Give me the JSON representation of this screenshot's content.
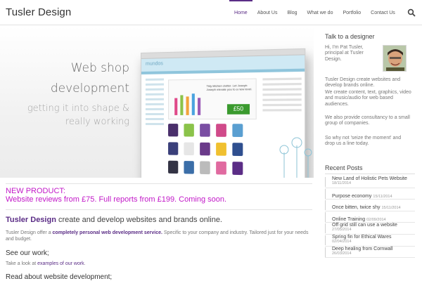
{
  "header": {
    "site_title": "Tusler Design",
    "nav": [
      "Home",
      "About Us",
      "Blog",
      "What we do",
      "Portfolio",
      "Contact Us"
    ],
    "active_nav": "Home",
    "search_icon": "search-icon"
  },
  "banner": {
    "line1": "Web shop",
    "line2": "development",
    "line3": "getting it into shape &",
    "line4": "really working",
    "mock": {
      "logo": "mundos",
      "feature": "Tidy kitchen clutter. Let Joseph Joseph elevate you to a new level.",
      "price": "£50"
    }
  },
  "main": {
    "new_product_line1": "NEW PRODUCT:",
    "new_product_line2": "Website reviews from £75. Full reports from £199. Coming soon.",
    "intro_strong": "Tusler Design",
    "intro_rest": " create and develop websites and brands online.",
    "body_a": "Tusler Design offer a ",
    "body_strong": "completely personal web development service.",
    "body_b": " Specific to your company and industry. Tailored just for your needs and budget.",
    "h_see": "See our work;",
    "p_see_a": "Take a look at ",
    "p_see_link": "examples of our work",
    "p_see_b": ".",
    "h_read": "Read about website development;"
  },
  "sidebar": {
    "talk_heading": "Talk to a designer",
    "intro": "Hi, I'm Pat Tusler, principal at Tusler Design.",
    "p1": "Tusler Design create websites and develop brands online.",
    "p2": "We create content, text, graphics, video and music/audio for web based audiences.",
    "p3": "We also provide consultancy to a small group of companies.",
    "p4": "So why not 'seize the moment' and drop us a line today.",
    "recent_heading": "Recent Posts",
    "posts": [
      {
        "title": "New Land of Holistic Pets Website",
        "date": "18/11/2014"
      },
      {
        "title": "Purpose economy",
        "date": "15/11/2014"
      },
      {
        "title": "Once bitten, twice shy",
        "date": "15/11/2014"
      },
      {
        "title": "Online Training",
        "date": "02/09/2014"
      },
      {
        "title": "Off grid still can use a website",
        "date": "27/05/2014"
      },
      {
        "title": "Spring fin for Ethical Wares",
        "date": "02/04/2014"
      },
      {
        "title": "Deep healing from Cornwall",
        "date": "26/03/2014"
      }
    ]
  },
  "colors": {
    "accent": "#5b2d86",
    "highlight": "#c218c8"
  }
}
